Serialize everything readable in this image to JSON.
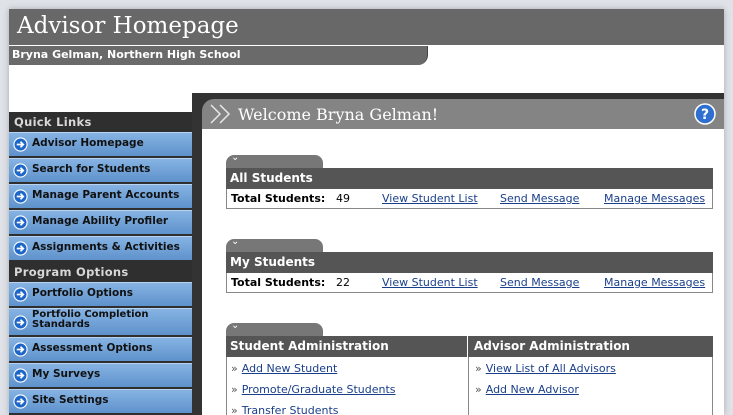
{
  "header": {
    "title": "Advisor Homepage",
    "subtitle": "Bryna Gelman, Northern High School"
  },
  "sidebar": {
    "quick_links_heading": "Quick Links",
    "quick_links": [
      {
        "label": "Advisor Homepage"
      },
      {
        "label": "Search for Students"
      },
      {
        "label": "Manage Parent Accounts"
      },
      {
        "label": "Manage Ability Profiler"
      },
      {
        "label": "Assignments & Activities"
      }
    ],
    "program_options_heading": "Program Options",
    "program_options": [
      {
        "label": "Portfolio Options"
      },
      {
        "label": "Portfolio Completion Standards"
      },
      {
        "label": "Assessment Options"
      },
      {
        "label": "My Surveys"
      },
      {
        "label": "Site Settings"
      }
    ]
  },
  "welcome": {
    "text": "Welcome Bryna Gelman!",
    "help_icon": "question-circle-icon"
  },
  "all_students": {
    "heading": "All Students",
    "total_label": "Total Students:",
    "total_value": "49",
    "view_list": "View Student List",
    "send_message": "Send Message",
    "manage_messages": "Manage Messages"
  },
  "my_students": {
    "heading": "My Students",
    "total_label": "Total Students:",
    "total_value": "22",
    "view_list": "View Student List",
    "send_message": "Send Message",
    "manage_messages": "Manage Messages"
  },
  "admin": {
    "student_heading": "Student Administration",
    "advisor_heading": "Advisor Administration",
    "bullet": "»",
    "student_links": [
      "Add New Student",
      "Promote/Graduate Students",
      "Transfer Students"
    ],
    "advisor_links": [
      "View List of All Advisors",
      "Add New Advisor"
    ]
  },
  "colors": {
    "title_bar": "#686868",
    "sidebar_bg": "#2f2f2f",
    "sidebar_button": "#6fa0d6",
    "link": "#1a3f8a"
  }
}
